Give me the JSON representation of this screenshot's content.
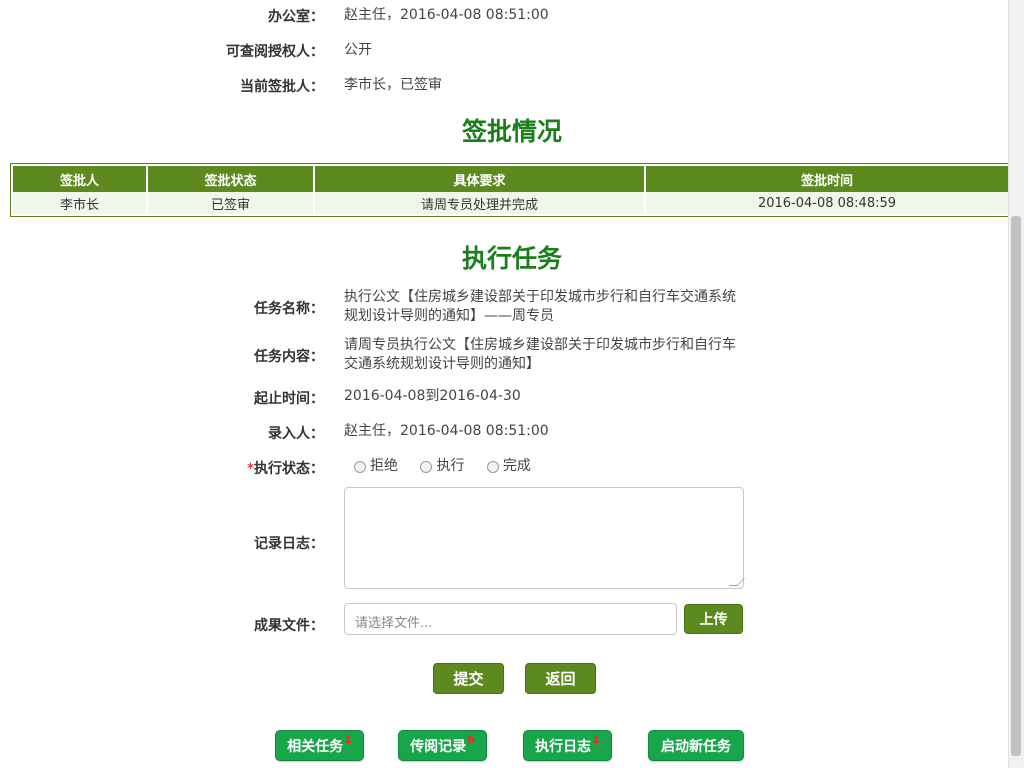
{
  "top": {
    "office_label": "办公室：",
    "office_value": "赵主任，2016-04-08 08:51:00",
    "auth_label": "可查阅授权人：",
    "auth_value": "公开",
    "signer_label": "当前签批人：",
    "signer_value": "李市长，已签审"
  },
  "sign_section": {
    "title": "签批情况",
    "headers": [
      "签批人",
      "签批状态",
      "具体要求",
      "签批时间"
    ],
    "rows": [
      [
        "李市长",
        "已签审",
        "请周专员处理并完成",
        "2016-04-08 08:48:59"
      ]
    ]
  },
  "task_section": {
    "title": "执行任务",
    "name_label": "任务名称：",
    "name_value": "执行公文【住房城乡建设部关于印发城市步行和自行车交通系统规划设计导则的通知】——周专员",
    "content_label": "任务内容：",
    "content_value": "请周专员执行公文【住房城乡建设部关于印发城市步行和自行车交通系统规划设计导则的通知】",
    "time_label": "起止时间：",
    "time_value": "2016-04-08到2016-04-30",
    "recorder_label": "录入人：",
    "recorder_value": "赵主任，2016-04-08 08:51:00",
    "status_required": "*",
    "status_label": "执行状态：",
    "status_options": [
      "拒绝",
      "执行",
      "完成"
    ],
    "log_label": "记录日志：",
    "log_value": "",
    "file_label": "成果文件：",
    "file_placeholder": "请选择文件...",
    "upload_label": "上传",
    "submit_label": "提交",
    "back_label": "返回"
  },
  "bottom_nav": [
    {
      "label": "相关任务",
      "badge": "1"
    },
    {
      "label": "传阅记录",
      "badge": "6"
    },
    {
      "label": "执行日志",
      "badge": "1"
    },
    {
      "label": "启动新任务",
      "badge": ""
    }
  ],
  "colors": {
    "title_green": "#1a7f1a",
    "header_green": "#5d8a1f",
    "nav_green": "#17a74a",
    "badge_red": "#ff2020"
  }
}
